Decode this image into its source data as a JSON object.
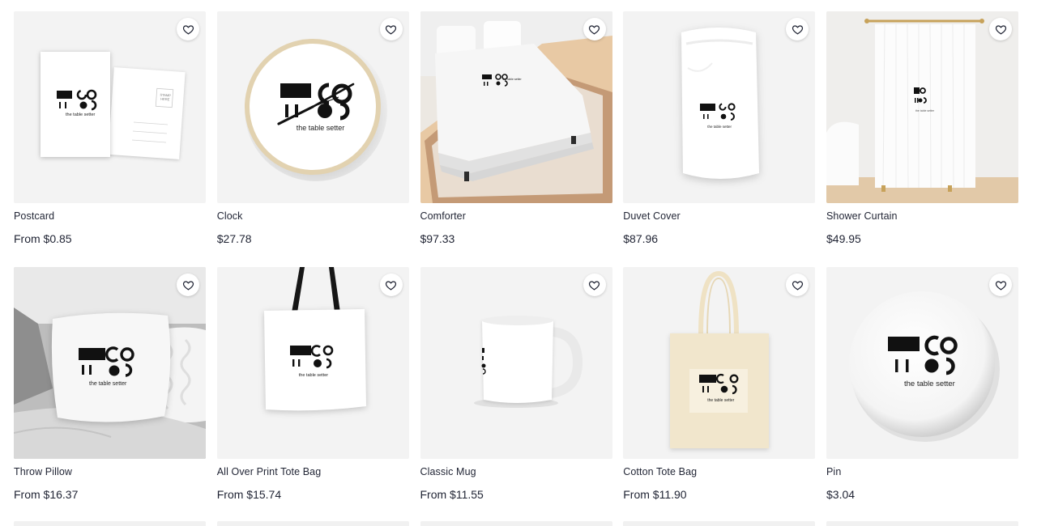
{
  "products": [
    {
      "name": "Postcard",
      "price": "From $0.85",
      "logo_text": "the table setter",
      "stamp_text": "STAMP HERE"
    },
    {
      "name": "Clock",
      "price": "$27.78",
      "logo_text": "the table setter"
    },
    {
      "name": "Comforter",
      "price": "$97.33",
      "logo_text": "the table setter"
    },
    {
      "name": "Duvet Cover",
      "price": "$87.96",
      "logo_text": "the table setter"
    },
    {
      "name": "Shower Curtain",
      "price": "$49.95",
      "logo_text": "the table setter"
    },
    {
      "name": "Throw Pillow",
      "price": "From $16.37",
      "logo_text": "the table setter"
    },
    {
      "name": "All Over Print Tote Bag",
      "price": "From $15.74",
      "logo_text": "the table setter"
    },
    {
      "name": "Classic Mug",
      "price": "From $11.55"
    },
    {
      "name": "Cotton Tote Bag",
      "price": "From $11.90",
      "logo_text": "the table setter"
    },
    {
      "name": "Pin",
      "price": "$3.04",
      "logo_text": "the table setter"
    }
  ],
  "colors": {
    "text": "#1f2333",
    "thumb_bg": "#f3f3f3",
    "logo": "#111111",
    "floor_wood": "#e8c9a4",
    "canvas_bag": "#f1e6cc"
  },
  "icons": {
    "favorite": "heart-outline-icon"
  }
}
